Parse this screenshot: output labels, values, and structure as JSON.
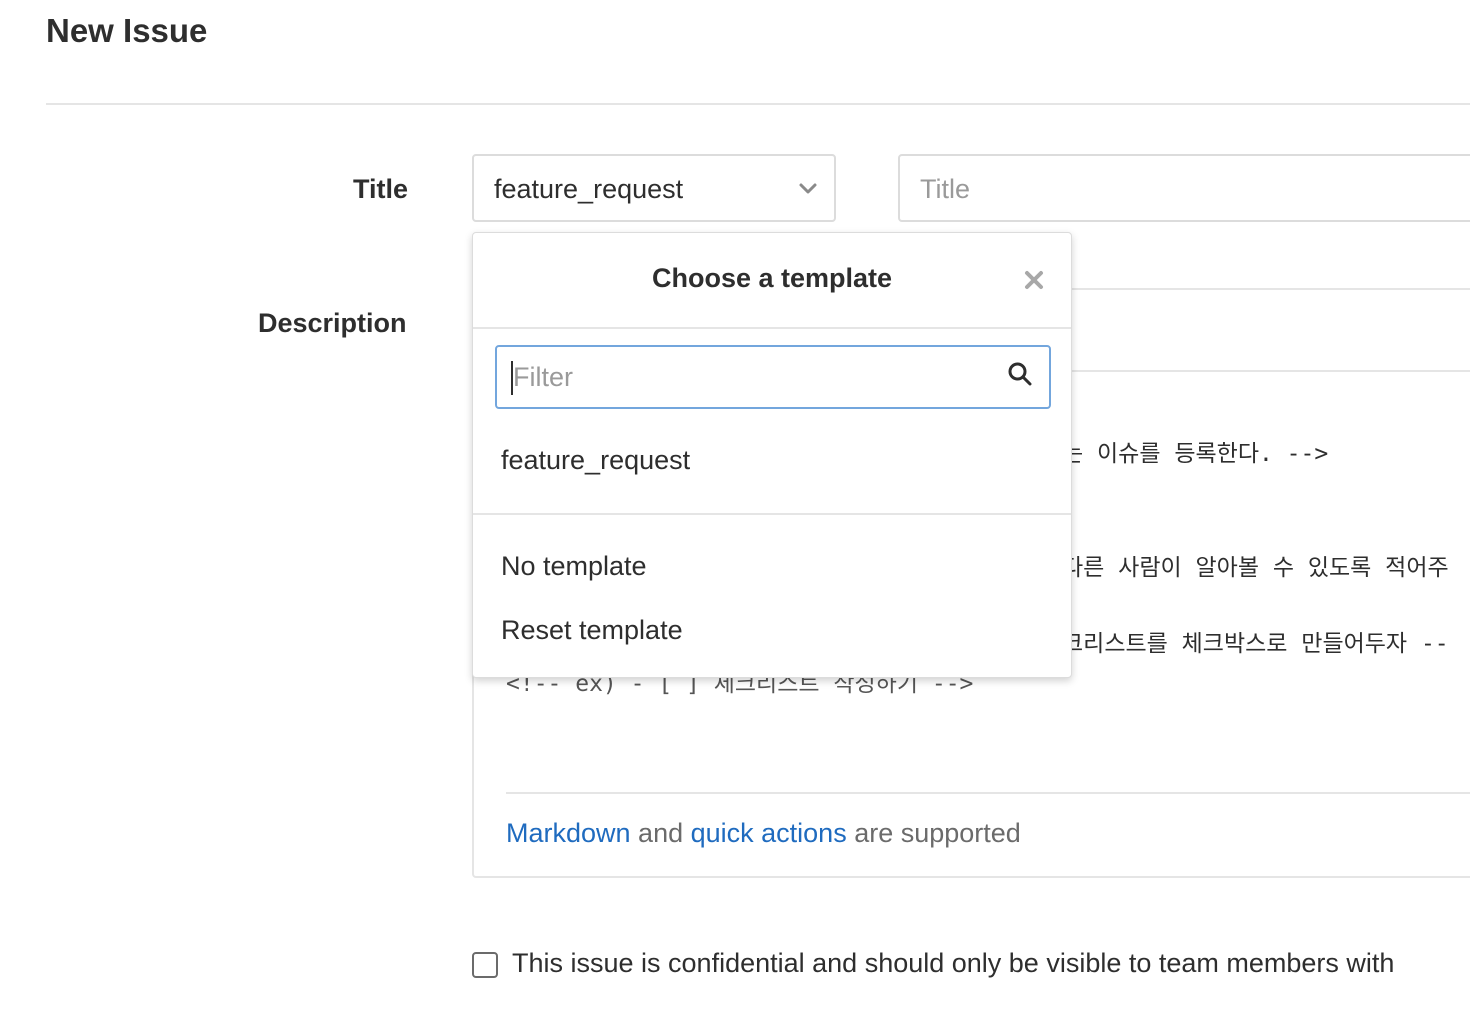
{
  "page": {
    "title": "New Issue"
  },
  "form": {
    "title_label": "Title",
    "description_label": "Description",
    "template_select_value": "feature_request",
    "title_placeholder": "Title"
  },
  "description": {
    "visible_lines": [
      "는 이슈를 등록한다. -->",
      "다른 사람이 알아볼 수 있도록 적어주",
      "크리스트를 체크박스로 만들어두자 --",
      "<!-- ex) - [ ] 체크리스트 작성하기 -->"
    ],
    "footer": {
      "markdown_link": "Markdown",
      "and": " and ",
      "quick_actions_link": "quick actions",
      "suffix": " are supported"
    }
  },
  "template_dropdown": {
    "title": "Choose a template",
    "filter_placeholder": "Filter",
    "templates": [
      "feature_request"
    ],
    "actions": [
      "No template",
      "Reset template"
    ]
  },
  "confidential": {
    "label": "This issue is confidential and should only be visible to team members with",
    "checked": false
  },
  "colors": {
    "link": "#1f6bbf",
    "focus_border": "#73a6dd"
  }
}
